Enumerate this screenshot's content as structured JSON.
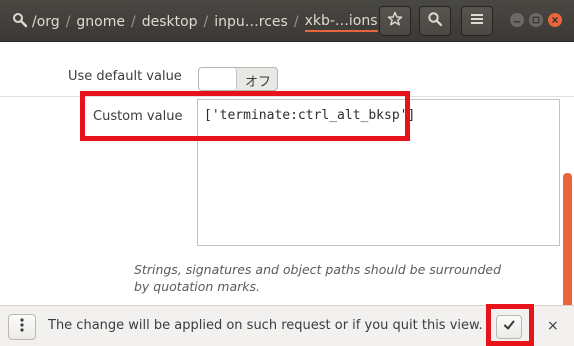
{
  "header": {
    "breadcrumbs": [
      {
        "label": "/org"
      },
      {
        "label": "gnome"
      },
      {
        "label": "desktop"
      },
      {
        "label": "inpu…rces"
      },
      {
        "label": "xkb-…ions"
      }
    ],
    "separator": "/",
    "buttons": {
      "bookmark_icon": "star-icon",
      "search_icon": "search-icon",
      "menu_icon": "hamburger-icon"
    },
    "window_controls": [
      "minimize",
      "maximize",
      "close"
    ],
    "accent_color": "#e9643a"
  },
  "settings": {
    "use_default_label": "Use default value",
    "use_default_state": "オフ",
    "custom_value_label": "Custom value",
    "custom_value": "['terminate:ctrl_alt_bksp']",
    "hint": "Strings, signatures and object paths should be surrounded by quotation marks."
  },
  "footer": {
    "message": "The change will be applied on such request or if you quit this view.",
    "apply_icon": "checkmark-icon",
    "dismiss_label": "×"
  },
  "annotation_color": "#e8131a"
}
